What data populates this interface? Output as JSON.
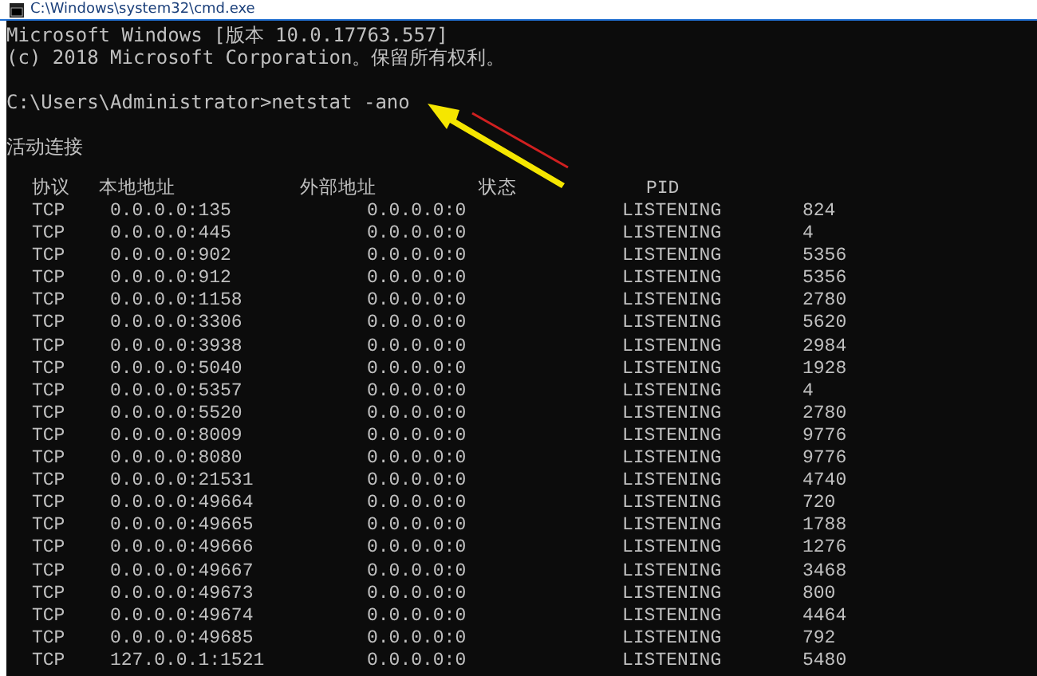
{
  "window": {
    "title": "C:\\Windows\\system32\\cmd.exe"
  },
  "banner": [
    "Microsoft Windows [版本 10.0.17763.557]",
    "(c) 2018 Microsoft Corporation。保留所有权利。"
  ],
  "prompt": "C:\\Users\\Administrator>netstat -ano",
  "section_title": "活动连接",
  "columns": [
    "协议",
    "本地地址",
    "外部地址",
    "状态",
    "PID"
  ],
  "rows": [
    [
      "TCP",
      "0.0.0.0:135",
      "0.0.0.0:0",
      "LISTENING",
      "824"
    ],
    [
      "TCP",
      "0.0.0.0:445",
      "0.0.0.0:0",
      "LISTENING",
      "4"
    ],
    [
      "TCP",
      "0.0.0.0:902",
      "0.0.0.0:0",
      "LISTENING",
      "5356"
    ],
    [
      "TCP",
      "0.0.0.0:912",
      "0.0.0.0:0",
      "LISTENING",
      "5356"
    ],
    [
      "TCP",
      "0.0.0.0:1158",
      "0.0.0.0:0",
      "LISTENING",
      "2780"
    ],
    [
      "TCP",
      "0.0.0.0:3306",
      "0.0.0.0:0",
      "LISTENING",
      "5620"
    ],
    [
      "TCP",
      "0.0.0.0:3938",
      "0.0.0.0:0",
      "LISTENING",
      "2984"
    ],
    [
      "TCP",
      "0.0.0.0:5040",
      "0.0.0.0:0",
      "LISTENING",
      "1928"
    ],
    [
      "TCP",
      "0.0.0.0:5357",
      "0.0.0.0:0",
      "LISTENING",
      "4"
    ],
    [
      "TCP",
      "0.0.0.0:5520",
      "0.0.0.0:0",
      "LISTENING",
      "2780"
    ],
    [
      "TCP",
      "0.0.0.0:8009",
      "0.0.0.0:0",
      "LISTENING",
      "9776"
    ],
    [
      "TCP",
      "0.0.0.0:8080",
      "0.0.0.0:0",
      "LISTENING",
      "9776"
    ],
    [
      "TCP",
      "0.0.0.0:21531",
      "0.0.0.0:0",
      "LISTENING",
      "4740"
    ],
    [
      "TCP",
      "0.0.0.0:49664",
      "0.0.0.0:0",
      "LISTENING",
      "720"
    ],
    [
      "TCP",
      "0.0.0.0:49665",
      "0.0.0.0:0",
      "LISTENING",
      "1788"
    ],
    [
      "TCP",
      "0.0.0.0:49666",
      "0.0.0.0:0",
      "LISTENING",
      "1276"
    ],
    [
      "TCP",
      "0.0.0.0:49667",
      "0.0.0.0:0",
      "LISTENING",
      "3468"
    ],
    [
      "TCP",
      "0.0.0.0:49673",
      "0.0.0.0:0",
      "LISTENING",
      "800"
    ],
    [
      "TCP",
      "0.0.0.0:49674",
      "0.0.0.0:0",
      "LISTENING",
      "4464"
    ],
    [
      "TCP",
      "0.0.0.0:49685",
      "0.0.0.0:0",
      "LISTENING",
      "792"
    ],
    [
      "TCP",
      "127.0.0.1:1521",
      "0.0.0.0:0",
      "LISTENING",
      "5480"
    ]
  ]
}
